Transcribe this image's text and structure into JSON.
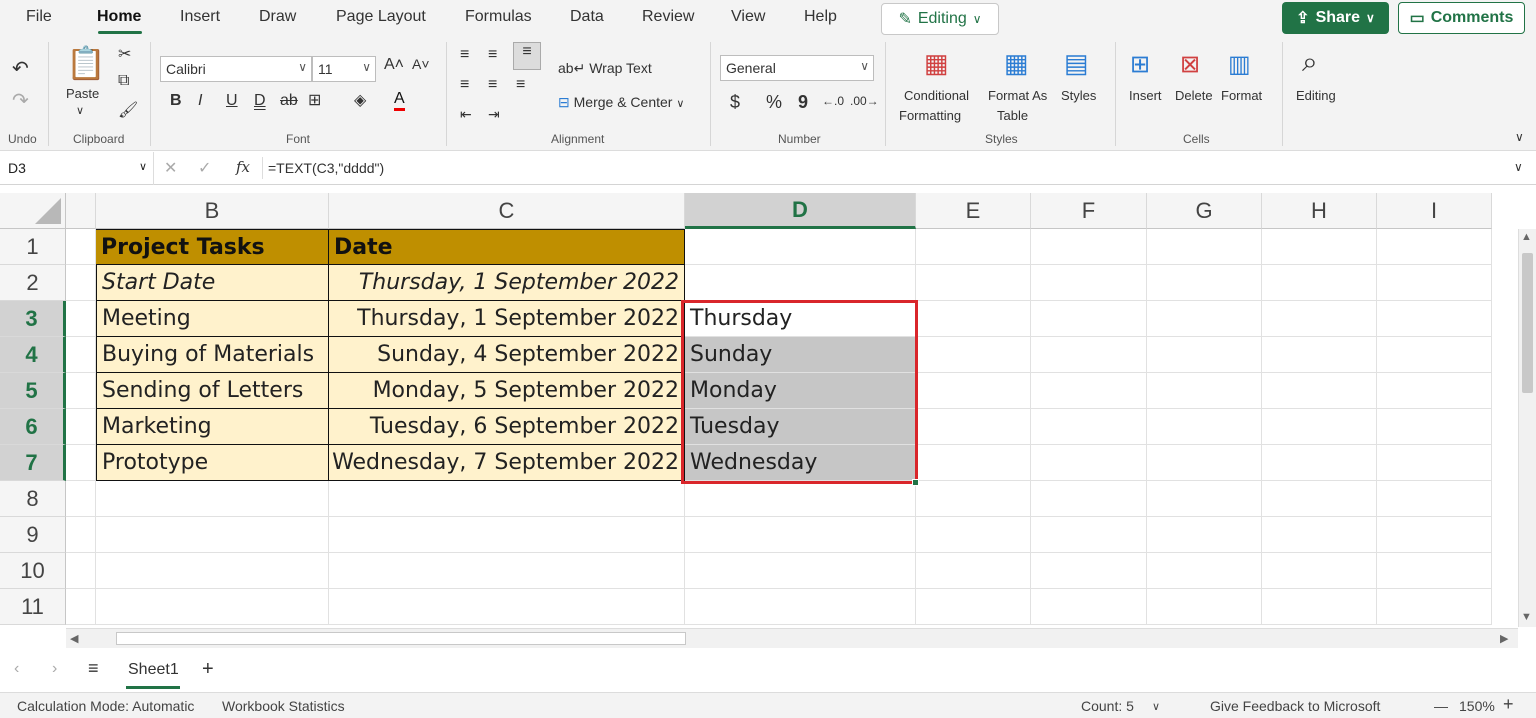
{
  "menu": {
    "file": "File",
    "home": "Home",
    "insert": "Insert",
    "draw": "Draw",
    "page_layout": "Page Layout",
    "formulas": "Formulas",
    "data": "Data",
    "review": "Review",
    "view": "View",
    "help": "Help",
    "editing": "Editing",
    "share": "Share",
    "comments": "Comments"
  },
  "ribbon": {
    "undo_label": "Undo",
    "clipboard": {
      "paste": "Paste",
      "label": "Clipboard"
    },
    "font": {
      "name": "Calibri",
      "size": "11",
      "label": "Font",
      "bold": "B",
      "italic": "I",
      "underline": "U",
      "double_underline": "D",
      "strike": "ab",
      "font_color": "A"
    },
    "alignment": {
      "wrap": "Wrap Text",
      "merge": "Merge & Center",
      "label": "Alignment"
    },
    "number": {
      "format": "General",
      "currency": "$",
      "percent": "%",
      "comma": "9",
      "label": "Number"
    },
    "styles": {
      "conditional_1": "Conditional",
      "conditional_2": "Formatting",
      "format_as_1": "Format As",
      "format_as_2": "Table",
      "styles": "Styles",
      "label": "Styles"
    },
    "cells": {
      "insert": "Insert",
      "delete": "Delete",
      "format": "Format",
      "label": "Cells"
    },
    "editing": {
      "label": "Editing"
    }
  },
  "formula_bar": {
    "name_box": "D3",
    "fx": "fx",
    "formula": "=TEXT(C3,\"dddd\")"
  },
  "columns": [
    "B",
    "C",
    "D",
    "E",
    "F",
    "G",
    "H",
    "I"
  ],
  "rows": [
    "1",
    "2",
    "3",
    "4",
    "5",
    "6",
    "7",
    "8",
    "9",
    "10",
    "11"
  ],
  "table": {
    "headers": [
      "Project Tasks",
      "Date"
    ],
    "rows": [
      {
        "task": "Start Date",
        "date": "Thursday, 1 September 2022",
        "day": ""
      },
      {
        "task": "Meeting",
        "date": "Thursday, 1 September 2022",
        "day": "Thursday"
      },
      {
        "task": "Buying of Materials",
        "date": "Sunday, 4 September 2022",
        "day": "Sunday"
      },
      {
        "task": "Sending of Letters",
        "date": "Monday, 5 September 2022",
        "day": "Monday"
      },
      {
        "task": "Marketing",
        "date": "Tuesday, 6 September 2022",
        "day": "Tuesday"
      },
      {
        "task": "Prototype",
        "date": "Wednesday, 7 September 2022",
        "day": "Wednesday"
      }
    ]
  },
  "sheet_tabs": {
    "active": "Sheet1",
    "add": "+"
  },
  "status": {
    "calc_mode": "Calculation Mode: Automatic",
    "workbook_stats": "Workbook Statistics",
    "count": "Count: 5",
    "feedback": "Give Feedback to Microsoft",
    "zoom_minus": "—",
    "zoom": "150%",
    "zoom_plus": "+"
  },
  "colors": {
    "accent": "#217346",
    "header_fill": "#bf8f00",
    "table_fill": "#fff2cc",
    "selection_outline": "#d9262b"
  }
}
